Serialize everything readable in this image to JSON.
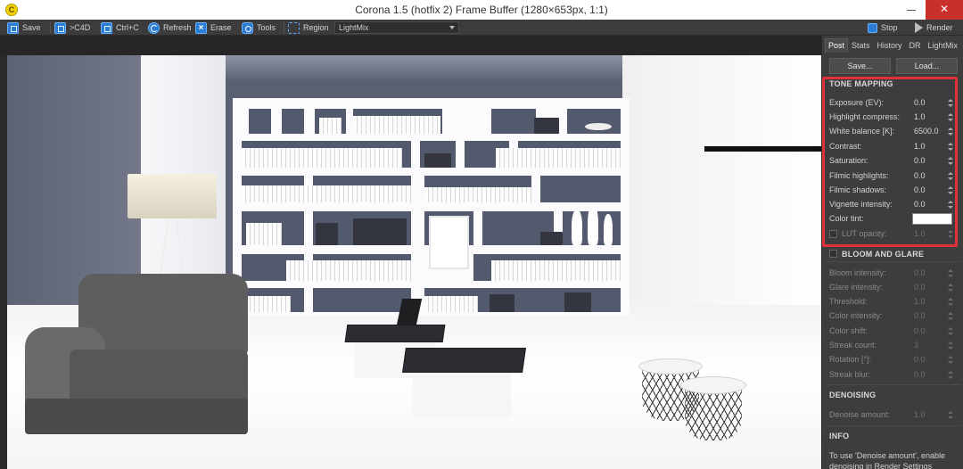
{
  "window": {
    "icon_glyph": "C",
    "title": "Corona 1.5 (hotfix 2) Frame Buffer (1280×653px, 1:1)",
    "close_glyph": "✕"
  },
  "toolbar": {
    "save": "Save",
    "to_c4d": ">C4D",
    "copy": "Ctrl+C",
    "refresh": "Refresh",
    "erase": "Erase",
    "tools": "Tools",
    "region": "Region",
    "lightmix_selected": "LightMix",
    "stop": "Stop",
    "render": "Render"
  },
  "panel": {
    "tabs": [
      {
        "label": "Post",
        "active": true
      },
      {
        "label": "Stats",
        "active": false
      },
      {
        "label": "History",
        "active": false
      },
      {
        "label": "DR",
        "active": false
      },
      {
        "label": "LightMix",
        "active": false
      }
    ],
    "save_button": "Save...",
    "load_button": "Load...",
    "tone_mapping": {
      "title": "TONE MAPPING",
      "rows": [
        {
          "label": "Exposure (EV):",
          "value": "0.0"
        },
        {
          "label": "Highlight compress:",
          "value": "1.0"
        },
        {
          "label": "White balance [K]:",
          "value": "6500.0"
        },
        {
          "label": "Contrast:",
          "value": "1.0"
        },
        {
          "label": "Saturation:",
          "value": "0.0"
        },
        {
          "label": "Filmic highlights:",
          "value": "0.0"
        },
        {
          "label": "Filmic shadows:",
          "value": "0.0"
        },
        {
          "label": "Vignette intensity:",
          "value": "0.0"
        }
      ],
      "color_tint_label": "Color tint:",
      "color_tint_value": "#ffffff",
      "lut_label": "LUT opacity:",
      "lut_value": "1.0"
    },
    "bloom_glare": {
      "title": "BLOOM AND GLARE",
      "rows": [
        {
          "label": "Bloom intensity:",
          "value": "0.0"
        },
        {
          "label": "Glare intensity:",
          "value": "0.0"
        },
        {
          "label": "Threshold:",
          "value": "1.0"
        },
        {
          "label": "Color intensity:",
          "value": "0.0"
        },
        {
          "label": "Color shift:",
          "value": "0.0"
        },
        {
          "label": "Streak count:",
          "value": "3"
        },
        {
          "label": "Rotation [°]:",
          "value": "0.0"
        },
        {
          "label": "Streak blur:",
          "value": "0.0"
        }
      ]
    },
    "denoising": {
      "title": "DENOISING",
      "amount_label": "Denoise amount:",
      "amount_value": "1.0"
    },
    "info": {
      "title": "INFO",
      "text": "To use 'Denoise amount', enable denoising in Render Settings"
    }
  },
  "colors": {
    "accent_blue": "#2b7cd3",
    "highlight_red": "#e0303a",
    "close_red": "#c9302c"
  }
}
